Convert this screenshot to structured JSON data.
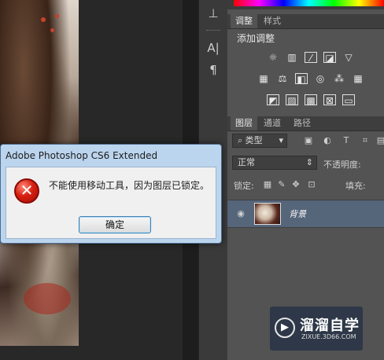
{
  "dialog": {
    "title": "Adobe Photoshop CS6 Extended",
    "message": "不能使用移动工具，因为图层已锁定。",
    "ok_label": "确定",
    "icon": "error-x-icon"
  },
  "adjust_panel": {
    "tabs": [
      "调整",
      "样式"
    ],
    "title": "添加调整"
  },
  "layers_panel": {
    "tabs": [
      "图层",
      "通道",
      "路径"
    ],
    "filter_label": "类型",
    "blend_mode": "正常",
    "opacity_label": "不透明度:",
    "lock_label": "锁定:",
    "fill_label": "填充:",
    "layer_name": "背景"
  },
  "watermark": {
    "title": "溜溜自学",
    "subtitle": "ZIXUE.3D66.COM"
  }
}
